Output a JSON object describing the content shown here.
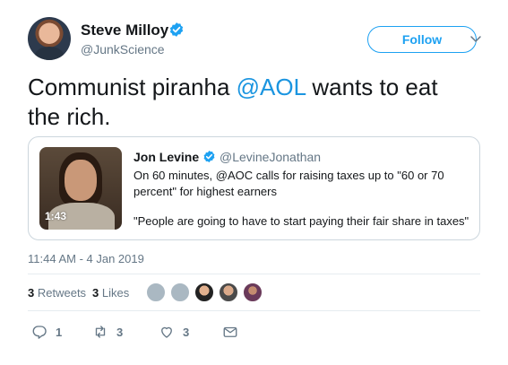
{
  "author": {
    "name": "Steve Milloy",
    "handle": "@JunkScience",
    "verified_icon": "verified-badge-icon",
    "follow_label": "Follow",
    "more_icon": "chevron-down-icon"
  },
  "tweet": {
    "text_before": "Communist piranha ",
    "mention": "@AOL",
    "text_after": " wants to eat the rich."
  },
  "quoted": {
    "name": "Jon Levine",
    "handle": "@LevineJonathan",
    "line1": "On 60 minutes, @AOC calls for raising taxes up to \"60 or 70",
    "line2": "percent\" for highest earners",
    "line3": "\"People are going to have to start paying their fair share in taxes\"",
    "video_duration": "1:43"
  },
  "timestamp": "11:44 AM - 4 Jan 2019",
  "stats": {
    "retweets_count": "3",
    "retweets_label": "Retweets",
    "likes_count": "3",
    "likes_label": "Likes"
  },
  "actions": {
    "reply_count": "1",
    "retweet_count": "3",
    "like_count": "3"
  },
  "colors": {
    "accent": "#1da1f2",
    "link": "#1b95e0",
    "muted": "#657786",
    "text": "#14171a",
    "border": "#ccd6dd"
  }
}
